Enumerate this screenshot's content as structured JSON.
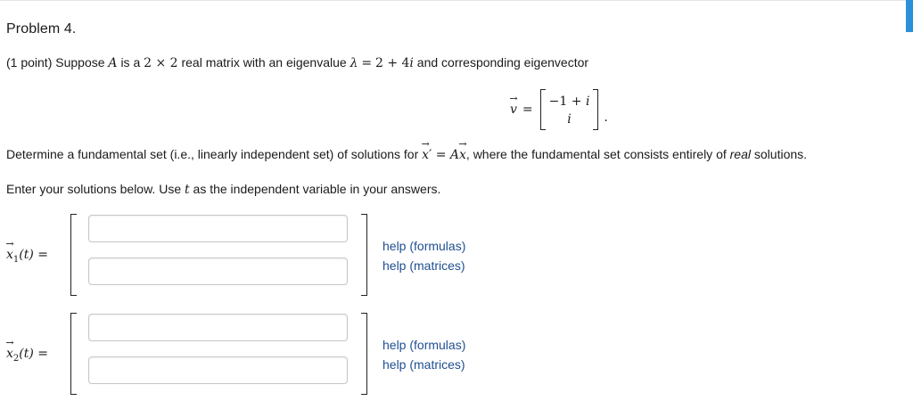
{
  "problem": {
    "title": "Problem 4.",
    "points": "(1 point)",
    "intro_1": "Suppose",
    "matrix_name": "A",
    "intro_2": "is a",
    "dims": "2 × 2",
    "intro_3": "real matrix with an eigenvalue",
    "lambda": "λ",
    "eq": "=",
    "eigenvalue": "2 + 4",
    "imag_unit": "i",
    "intro_4": "and corresponding eigenvector",
    "eigvec_name": "v",
    "eigvec_eq": "=",
    "eigvec_top": "−1 + ",
    "eigvec_top_i": "i",
    "eigvec_bottom": "i",
    "eigvec_period": "."
  },
  "instructions": {
    "line2_a": "Determine a fundamental set (i.e., linearly independent set) of solutions for",
    "x_symbol": "x",
    "prime": "′",
    "eq": " = ",
    "a_symbol": "A",
    "x_symbol2": "x",
    "line2_b": ", where the fundamental set consists entirely of",
    "real_word": "real",
    "line2_c": "solutions.",
    "line3_a": "Enter your solutions below. Use",
    "t_symbol": "t",
    "line3_b": "as the independent variable in your answers."
  },
  "solutions": [
    {
      "vec": "x",
      "subscript": "1",
      "arg": "(t)",
      "eq": " =",
      "inputs": [
        "",
        ""
      ],
      "help_formulas": "help (formulas)",
      "help_matrices": "help (matrices)"
    },
    {
      "vec": "x",
      "subscript": "2",
      "arg": "(t)",
      "eq": " =",
      "inputs": [
        "",
        ""
      ],
      "help_formulas": "help (formulas)",
      "help_matrices": "help (matrices)"
    }
  ],
  "colors": {
    "link": "#1f4f91",
    "input_border": "#c6c6c6",
    "edge_tab": "#2b90d9"
  }
}
